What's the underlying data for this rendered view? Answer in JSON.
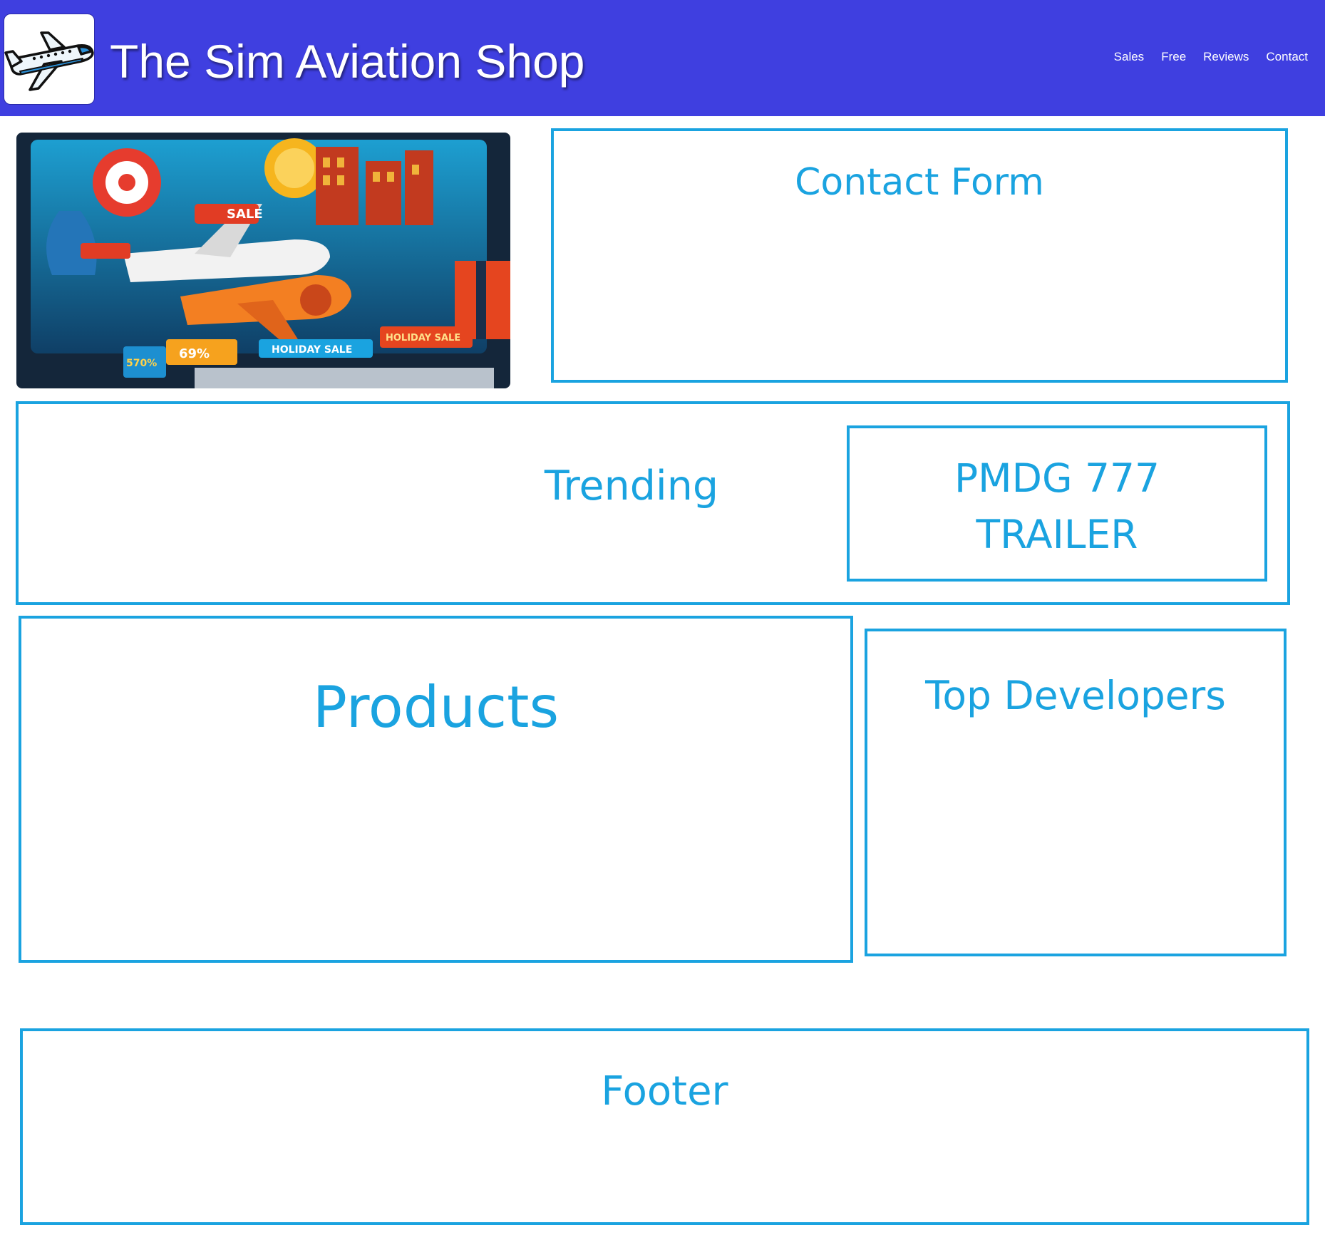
{
  "header": {
    "logo_icon": "airplane-icon",
    "title": "The Sim Aviation Shop",
    "nav": [
      "Sales",
      "Free",
      "Reviews",
      "Contact"
    ]
  },
  "hero": {
    "image": "holiday-sale-banner",
    "visible_text": [
      "SALE",
      "HOLIDAY SALE",
      "HOLIDAY SALE",
      "69%",
      "570%"
    ]
  },
  "sections": {
    "contact_form": "Contact Form",
    "trending": "Trending",
    "trailer_line1": "PMDG 777",
    "trailer_line2": "TRAILER",
    "products": "Products",
    "top_developers": "Top Developers",
    "footer": "Footer"
  },
  "colors": {
    "header_bg": "#3f3fe0",
    "box_border": "#1aa3e0",
    "text_on_header": "#ffffff"
  }
}
